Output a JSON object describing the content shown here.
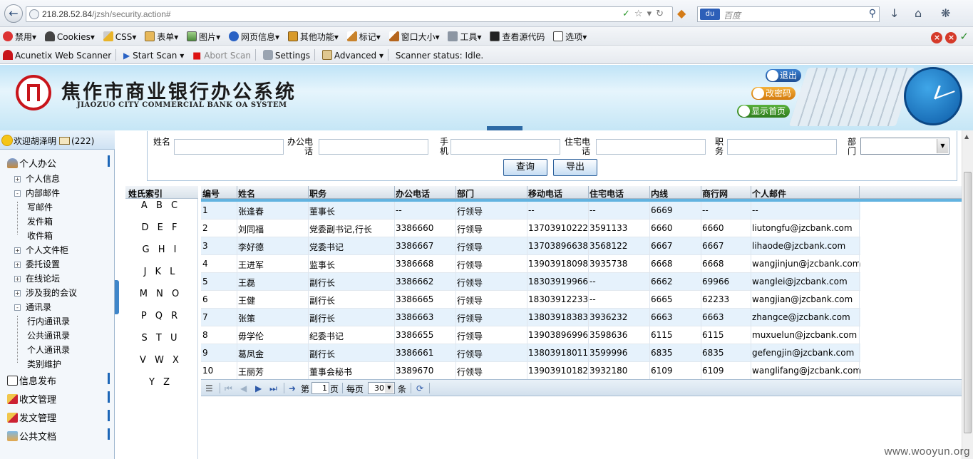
{
  "browser": {
    "url": "218.28.52.84/jzsh/security.action#",
    "url_host": "218.28.52.84",
    "url_path": "/jzsh/security.action#",
    "search_placeholder": "百度",
    "search_engine_icon": "baidu-paw-icon"
  },
  "webdev_toolbar": {
    "items": [
      "禁用",
      "Cookies",
      "CSS",
      "表单",
      "图片",
      "网页信息",
      "其他功能",
      "标记",
      "窗口大小",
      "工具",
      "查看源代码",
      "选项"
    ]
  },
  "acunetix_toolbar": {
    "brand": "Acunetix Web Scanner",
    "start_scan": "Start Scan",
    "abort_scan": "Abort Scan",
    "settings": "Settings",
    "advanced": "Advanced",
    "status": "Scanner status: Idle."
  },
  "banner": {
    "title": "焦作市商业银行办公系统",
    "subtitle": "JIAOZUO CITY COMMERCIAL BANK OA SYSTEM",
    "exit_label": "退出",
    "change_password_label": "改密码",
    "home_label": "显示首页"
  },
  "sidebar": {
    "welcome": "欢迎胡泽明",
    "mail_count": "(222)",
    "sections": [
      {
        "label": "个人办公"
      },
      {
        "label": "信息发布"
      },
      {
        "label": "收文管理"
      },
      {
        "label": "发文管理"
      },
      {
        "label": "公共文档"
      }
    ],
    "personal_items": [
      "个人信息",
      "内部邮件",
      "写邮件",
      "发件箱",
      "收件箱",
      "个人文件柜",
      "委托设置",
      "在线论坛",
      "涉及我的会议",
      "通讯录",
      "行内通讯录",
      "公共通讯录",
      "个人通讯录",
      "类别维护"
    ]
  },
  "search_form": {
    "name_label": "姓名",
    "office_phone_label": "办公电话",
    "mobile_label": "手机",
    "home_phone_label": "住宅电话",
    "position_label": "职务",
    "dept_label": "部门",
    "query_button": "查询",
    "export_button": "导出"
  },
  "index": {
    "header": "姓氏索引",
    "rows": [
      "A B C",
      "D E F",
      "G H I",
      "J K L",
      "M N O",
      "P Q R",
      "S T U",
      "V W X",
      "Y Z"
    ]
  },
  "grid": {
    "columns": [
      "编号",
      "姓名",
      "职务",
      "办公电话",
      "部门",
      "移动电话",
      "住宅电话",
      "内线",
      "商行网",
      "个人邮件"
    ],
    "rows": [
      [
        "1",
        "张逢春",
        "董事长",
        "--",
        "行领导",
        "--",
        "--",
        "6669",
        "--",
        "--"
      ],
      [
        "2",
        "刘同福",
        "党委副书记,行长",
        "3386660",
        "行领导",
        "13703910222",
        "3591133",
        "6660",
        "6660",
        "liutongfu@jzcbank.com"
      ],
      [
        "3",
        "李好德",
        "党委书记",
        "3386667",
        "行领导",
        "13703896638",
        "3568122",
        "6667",
        "6667",
        "lihaode@jzcbank.com"
      ],
      [
        "4",
        "王进军",
        "监事长",
        "3386668",
        "行领导",
        "13903918098",
        "3935738",
        "6668",
        "6668",
        "wangjinjun@jzcbank.com"
      ],
      [
        "5",
        "王磊",
        "副行长",
        "3386662",
        "行领导",
        "18303919966",
        "--",
        "6662",
        "69966",
        "wanglei@jzcbank.com"
      ],
      [
        "6",
        "王健",
        "副行长",
        "3386665",
        "行领导",
        "18303912233",
        "--",
        "6665",
        "62233",
        "wangjian@jzcbank.com"
      ],
      [
        "7",
        "张策",
        "副行长",
        "3386663",
        "行领导",
        "13803918383",
        "3936232",
        "6663",
        "6663",
        "zhangce@jzcbank.com"
      ],
      [
        "8",
        "毋学伦",
        "纪委书记",
        "3386655",
        "行领导",
        "13903896996",
        "3598636",
        "6115",
        "6115",
        "muxuelun@jzcbank.com"
      ],
      [
        "9",
        "葛凤金",
        "副行长",
        "3386661",
        "行领导",
        "13803918011",
        "3599996",
        "6835",
        "6835",
        "gefengjin@jzcbank.com"
      ],
      [
        "10",
        "王丽芳",
        "董事会秘书",
        "3389670",
        "行领导",
        "13903910182",
        "3932180",
        "6109",
        "6109",
        "wanglifang@jzcbank.com"
      ]
    ]
  },
  "pager": {
    "page_prefix": "第",
    "page_value": "1",
    "page_suffix": "页",
    "per_page_prefix": "每页",
    "per_page_value": "30",
    "per_page_suffix": "条"
  },
  "watermark": "www.wooyun.org"
}
